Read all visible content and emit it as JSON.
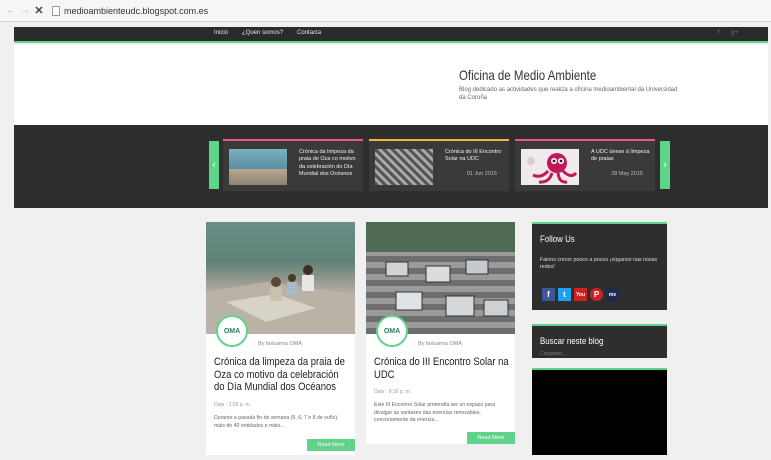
{
  "browser": {
    "url": "medioambienteudc.blogspot.com.es"
  },
  "nav": {
    "links": [
      "Inicio",
      "¿Quen somos?",
      "Contacta"
    ],
    "social": [
      "f",
      "g+"
    ]
  },
  "header": {
    "title": "Oficina de Medio Ambiente",
    "description": "Blog dedicado as actividades que realiza a oficina medioambiental da Universidad da Coruña"
  },
  "slider": {
    "slides": [
      {
        "title": "Crónica da limpeza da praia de Oza co motivo da celebración do Día Mundial dos Océanos",
        "date": ""
      },
      {
        "title": "Crónica do III Encontro Solar na UDC",
        "date": "01 Jun 2015"
      },
      {
        "title": "A UDC únese á limpeza de praias",
        "date": "28 May 2015"
      }
    ]
  },
  "posts": [
    {
      "avatar": "OMA",
      "author": "By bolsaima OMA",
      "title": "Crónica da limpeza da praia de Oza co motivo da celebración do Día Mundial dos Océanos",
      "date": "Date : 2:02 p. m.",
      "excerpt": "Durante a pasada fin de semana (5, 6, 7 e 8 de xuño), máis de 40 entidades e máis...",
      "read_more": "Read More"
    },
    {
      "avatar": "OMA",
      "author": "By bolsaima OMA",
      "title": "Crónica do III Encontro Solar na UDC",
      "date": "Date : 9:16 p. m.",
      "excerpt": "Este III Encontro Solar pretendía ser un espazo para divulgar as vantaxes das enerxías renovables, concretamente da enerxía...",
      "read_more": "Read More"
    }
  ],
  "sidebar": {
    "follow": {
      "title": "Follow Us",
      "text": "Fainos crecer pouco a pouco ¡xúganos nas nosas redes!",
      "icons": [
        "f",
        "t",
        "You",
        "P",
        "me"
      ]
    },
    "search": {
      "title": "Buscar neste blog",
      "subtitle": "Cargando..."
    }
  }
}
